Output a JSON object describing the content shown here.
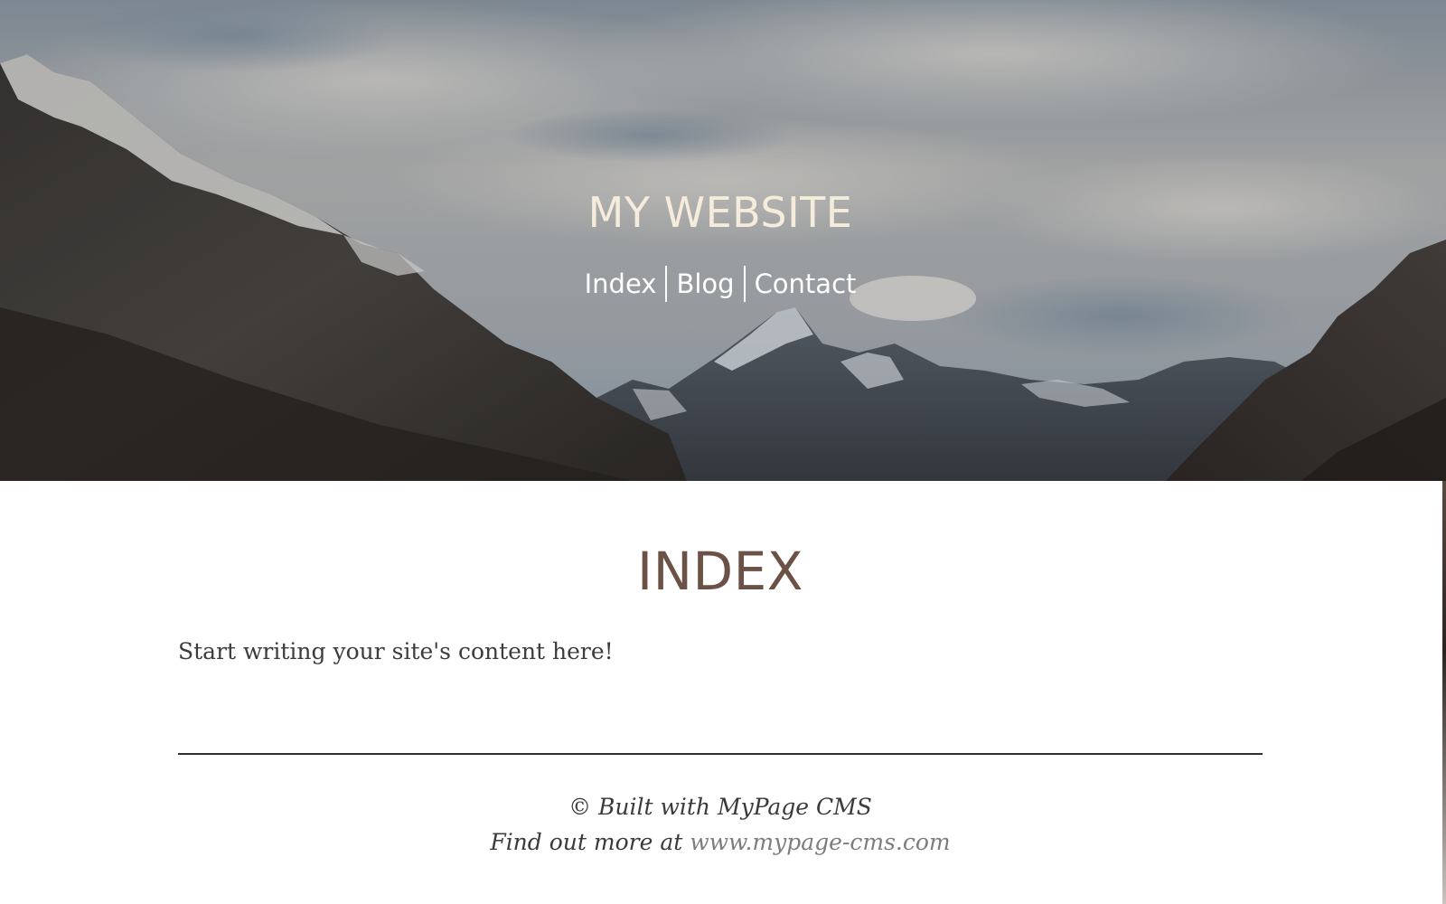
{
  "header": {
    "site_title": "MY WEBSITE",
    "nav": [
      {
        "label": "Index"
      },
      {
        "label": "Blog"
      },
      {
        "label": "Contact"
      }
    ]
  },
  "main": {
    "heading": "INDEX",
    "content": "Start writing your site's content here!"
  },
  "footer": {
    "line1": "© Built with MyPage CMS",
    "line2_prefix": "Find out more at ",
    "link_text": "www.mypage-cms.com"
  },
  "colors": {
    "title": "#f6ecdc",
    "heading": "#6b5146",
    "body_text": "#3c3c3c",
    "link": "#7d7d7d"
  }
}
